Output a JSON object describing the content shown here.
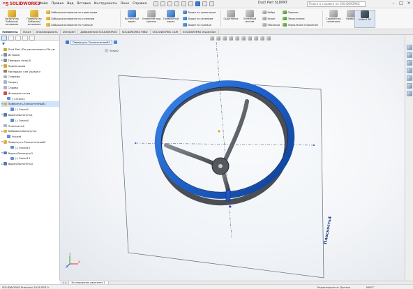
{
  "app": {
    "logo_text": "SOLIDWORKS",
    "document_title": "Duct Part SLDPRT",
    "search_placeholder": "Поиск в справке по SOLIDWORKS"
  },
  "menu": [
    "Файл",
    "Правка",
    "Вид",
    "Вставка",
    "Инструменты",
    "Окно",
    "Справка"
  ],
  "ribbon": {
    "big_buttons": [
      {
        "label": "Вытянутая Бобышка/основание"
      },
      {
        "label": "Повернутая Бобышка/основание"
      },
      {
        "label": "Вытянутый вырез"
      },
      {
        "label": "Отверстие под крепеж"
      },
      {
        "label": "Повернутый вырез"
      },
      {
        "label": "Скругление"
      },
      {
        "label": "Линейный массив"
      },
      {
        "label": "Справочная геометрия"
      },
      {
        "label": "Кривые"
      },
      {
        "label": "Instant 3D"
      }
    ],
    "small_col1": [
      "Бобышка/основание по траектории",
      "Бобышка/основание по сечениям",
      "Бобышка/основание по границе"
    ],
    "small_col2": [
      "Вырез по траектории",
      "Вырез по сечениям",
      "Вырез по границе"
    ],
    "small_col3": [
      "Ребро",
      "Уклон",
      "Оболочка"
    ],
    "small_col4": [
      "Перенос",
      "Пересечение",
      "Зеркальное отражение"
    ]
  },
  "command_tabs": [
    "Элементы",
    "Эскиз",
    "Анализировать",
    "DimXpert",
    "Добавления SOLIDWORKS",
    "SOLIDWORKS MBD",
    "SOLIDWORKS CAM",
    "SOLIDWORKS Inspection"
  ],
  "tree": [
    {
      "label": "Duct Part (По умолчанию<<По ум",
      "level": 0,
      "expand": "",
      "icon": "part"
    },
    {
      "label": "История",
      "level": 0,
      "expand": "▸",
      "icon": "history"
    },
    {
      "label": "Твердые тела(3)",
      "level": 0,
      "expand": "▸",
      "icon": "solid"
    },
    {
      "label": "Примечания",
      "level": 0,
      "expand": "▸",
      "icon": "note"
    },
    {
      "label": "Материал <не указан>",
      "level": 0,
      "expand": "",
      "icon": "material"
    },
    {
      "label": "Спереди",
      "level": 0,
      "expand": "",
      "icon": "plane"
    },
    {
      "label": "Сверху",
      "level": 0,
      "expand": "",
      "icon": "plane"
    },
    {
      "label": "Справа",
      "level": 0,
      "expand": "",
      "icon": "plane"
    },
    {
      "label": "Исходная точка",
      "level": 0,
      "expand": "",
      "icon": "origin"
    },
    {
      "label": "(-) Эскиз1",
      "level": 1,
      "expand": "",
      "icon": "sketch"
    },
    {
      "label": "Повернуть-Тонкостенный1",
      "level": 0,
      "expand": "▾",
      "icon": "feature",
      "selected": true
    },
    {
      "label": "(-) Эскиз2",
      "level": 2,
      "expand": "",
      "icon": "sketch"
    },
    {
      "label": "Вырез-Вытянуть1",
      "level": 0,
      "expand": "▾",
      "icon": "cut"
    },
    {
      "label": "(-) Эскиз4",
      "level": 2,
      "expand": "",
      "icon": "sketch"
    },
    {
      "label": "Плоскость4",
      "level": 0,
      "expand": "",
      "icon": "plane"
    },
    {
      "label": "Бобышка-Вытянуть1",
      "level": 0,
      "expand": "▸",
      "icon": "boss"
    },
    {
      "label": "Эскиз9",
      "level": 1,
      "expand": "",
      "icon": "sketch"
    },
    {
      "label": "Повернуть-Тонкостенный2",
      "level": 0,
      "expand": "▾",
      "icon": "feature"
    },
    {
      "label": "(-) Эскиз10",
      "level": 2,
      "expand": "",
      "icon": "sketch"
    },
    {
      "label": "Вырез-Вытянуть3",
      "level": 0,
      "expand": "▾",
      "icon": "cut"
    },
    {
      "label": "(-) Эскиз11",
      "level": 2,
      "expand": "",
      "icon": "sketch"
    },
    {
      "label": "Вырез-Вытянуть4",
      "level": 0,
      "expand": "▸",
      "icon": "cut"
    }
  ],
  "viewport": {
    "breadcrumb": "Повернуть-Тонкостенный1",
    "breadcrumb_sub": "Эскиз2",
    "plane_label": "Плоскость4",
    "triad": {
      "x": "X",
      "y": "Y",
      "z": "Z"
    }
  },
  "bottom_tab": "Исследование движения 1",
  "status": {
    "left": "SOLIDWORKS Premium 2018 SP3.0",
    "mode": "Редактируется: Деталь",
    "units": "MMГС"
  }
}
